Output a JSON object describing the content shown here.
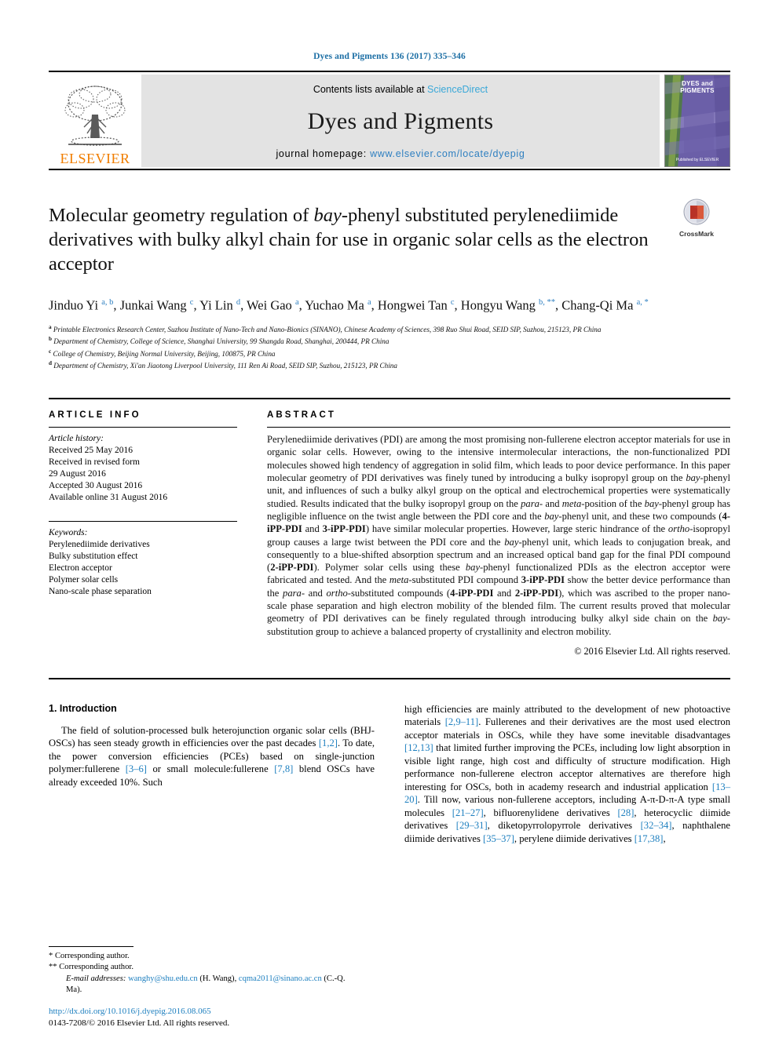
{
  "running_head": "Dyes and Pigments 136 (2017) 335–346",
  "masthead": {
    "contents_prefix": "Contents lists available at ",
    "sciencedirect": "ScienceDirect",
    "journal_name": "Dyes and Pigments",
    "homepage_label": "journal homepage: ",
    "homepage_url": "www.elsevier.com/locate/dyepig",
    "publisher": "ELSEVIER",
    "cover_title": "DYES and PIGMENTS",
    "cover_foot": "Published by ELSEVIER",
    "accent_blue": "#2e7fc0",
    "accent_orange": "#f07d00",
    "cover_purple": "#6b5fa8"
  },
  "article": {
    "title_part1": "Molecular geometry regulation of ",
    "title_em1": "bay",
    "title_part2": "-phenyl substituted perylenediimide derivatives with bulky alkyl chain for use in organic solar cells as the electron acceptor",
    "crossmark_label": "CrossMark",
    "authors_html": "Jinduo Yi <sup>a, b</sup>, Junkai Wang <sup>c</sup>, Yi Lin <sup>d</sup>, Wei Gao <sup>a</sup>, Yuchao Ma <sup>a</sup>, Hongwei Tan <sup>c</sup>, Hongyu Wang <sup>b, **</sup>, Chang-Qi Ma <sup>a, *</sup>",
    "affiliations": [
      {
        "mark": "a",
        "text": "Printable Electronics Research Center, Suzhou Institute of Nano-Tech and Nano-Bionics (SINANO), Chinese Academy of Sciences, 398 Ruo Shui Road, SEID SIP, Suzhou, 215123, PR China"
      },
      {
        "mark": "b",
        "text": "Department of Chemistry, College of Science, Shanghai University, 99 Shangda Road, Shanghai, 200444, PR China"
      },
      {
        "mark": "c",
        "text": "College of Chemistry, Beijing Normal University, Beijing, 100875, PR China"
      },
      {
        "mark": "d",
        "text": "Department of Chemistry, Xi'an Jiaotong Liverpool University, 111 Ren Ai Road, SEID SIP, Suzhou, 215123, PR China"
      }
    ]
  },
  "article_info": {
    "heading": "ARTICLE INFO",
    "history_label": "Article history:",
    "history": [
      "Received 25 May 2016",
      "Received in revised form",
      "29 August 2016",
      "Accepted 30 August 2016",
      "Available online 31 August 2016"
    ],
    "keywords_label": "Keywords:",
    "keywords": [
      "Perylenediimide derivatives",
      "Bulky substitution effect",
      "Electron acceptor",
      "Polymer solar cells",
      "Nano-scale phase separation"
    ]
  },
  "abstract": {
    "heading": "ABSTRACT",
    "text_html": "Perylenediimide derivatives (PDI) are among the most promising non-fullerene electron acceptor materials for use in organic solar cells. However, owing to the intensive intermolecular interactions, the non-functionalized PDI molecules showed high tendency of aggregation in solid film, which leads to poor device performance. In this paper molecular geometry of PDI derivatives was finely tuned by introducing a bulky isopropyl group on the <em>bay</em>-phenyl unit, and influences of such a bulky alkyl group on the optical and electrochemical properties were systematically studied. Results indicated that the bulky isopropyl group on the <em>para</em>- and <em>meta</em>-position of the <em>bay</em>-phenyl group has negligible influence on the twist angle between the PDI core and the <em>bay</em>-phenyl unit, and these two compounds (<strong>4-iPP-PDI</strong> and <strong>3-iPP-PDI</strong>) have similar molecular properties. However, large steric hindrance of the <em>ortho</em>-isopropyl group causes a large twist between the PDI core and the <em>bay</em>-phenyl unit, which leads to conjugation break, and consequently to a blue-shifted absorption spectrum and an increased optical band gap for the final PDI compound (<strong>2-iPP-PDI</strong>). Polymer solar cells using these <em>bay</em>-phenyl functionalized PDIs as the electron acceptor were fabricated and tested. And the <em>meta</em>-substituted PDI compound <strong>3-iPP-PDI</strong> show the better device performance than the <em>para</em>- and <em>ortho</em>-substituted compounds (<strong>4-iPP-PDI</strong> and <strong>2-iPP-PDI</strong>), which was ascribed to the proper nano-scale phase separation and high electron mobility of the blended film. The current results proved that molecular geometry of PDI derivatives can be finely regulated through introducing bulky alkyl side chain on the <em>bay</em>-substitution group to achieve a balanced property of crystallinity and electron mobility.",
    "copyright": "© 2016 Elsevier Ltd. All rights reserved."
  },
  "body": {
    "section_heading": "1. Introduction",
    "left_paragraph_html": "The field of solution-processed bulk heterojunction organic solar cells (BHJ-OSCs) has seen steady growth in efficiencies over the past decades <span class=\"ref\">[1,2]</span>. To date, the power conversion efficiencies (PCEs) based on single-junction polymer:fullerene <span class=\"ref\">[3–6]</span> or small molecule:fullerene <span class=\"ref\">[7,8]</span> blend OSCs have already exceeded 10%. Such",
    "right_paragraph_html": "high efficiencies are mainly attributed to the development of new photoactive materials <span class=\"ref\">[2,9–11]</span>. Fullerenes and their derivatives are the most used electron acceptor materials in OSCs, while they have some inevitable disadvantages <span class=\"ref\">[12,13]</span> that limited further improving the PCEs, including low light absorption in visible light range, high cost and difficulty of structure modification. High performance non-fullerene electron acceptor alternatives are therefore high interesting for OSCs, both in academy research and industrial application <span class=\"ref\">[13–20]</span>. Till now, various non-fullerene acceptors, including A-π-D-π-A type small molecules <span class=\"ref\">[21–27]</span>, bifluorenylidene derivatives <span class=\"ref\">[28]</span>, heterocyclic diimide derivatives <span class=\"ref\">[29–31]</span>, diketopyrrolopyrrole derivatives <span class=\"ref\">[32–34]</span>, naphthalene diimide derivatives <span class=\"ref\">[35–37]</span>, perylene diimide derivatives <span class=\"ref\">[17,38]</span>,"
  },
  "footnotes": {
    "corresponding_1": "* Corresponding author.",
    "corresponding_2": "** Corresponding author.",
    "email_label": "E-mail addresses:",
    "email_1": "wanghy@shu.edu.cn",
    "email_1_owner": "(H. Wang),",
    "email_2": "cqma2011@sinano.ac.cn",
    "email_2_owner": "(C.-Q. Ma).",
    "doi": "http://dx.doi.org/10.1016/j.dyepig.2016.08.065",
    "issn_line": "0143-7208/© 2016 Elsevier Ltd. All rights reserved."
  }
}
